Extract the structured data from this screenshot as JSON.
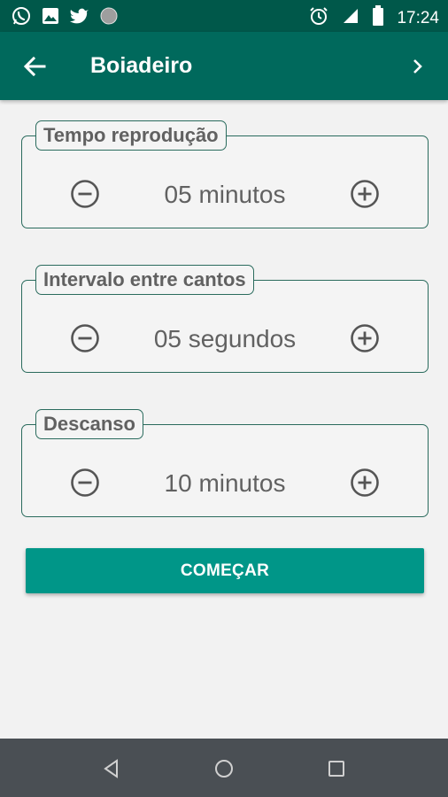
{
  "status_bar": {
    "time": "17:24",
    "left_icons": [
      "whatsapp-icon",
      "image-icon",
      "twitter-icon",
      "circle-icon"
    ],
    "right_icons": [
      "alarm-icon",
      "signal-icon",
      "battery-icon"
    ]
  },
  "app_bar": {
    "title": "Boiadeiro",
    "back_icon": "arrow-left-icon",
    "next_icon": "chevron-right-icon"
  },
  "settings": [
    {
      "label": "Tempo reprodução",
      "value": "05 minutos"
    },
    {
      "label": "Intervalo entre cantos",
      "value": "05 segundos"
    },
    {
      "label": "Descanso",
      "value": "10 minutos"
    }
  ],
  "start_button": {
    "label": "COMEÇAR"
  },
  "nav_bar": {
    "buttons": [
      "back-triangle-icon",
      "home-circle-icon",
      "recents-square-icon"
    ]
  },
  "colors": {
    "status_bar": "#00584a",
    "app_bar": "#00695c",
    "accent": "#009688",
    "card_border": "#2a6b5d",
    "text_gray": "#616161",
    "nav_bar": "#4a4f54"
  }
}
